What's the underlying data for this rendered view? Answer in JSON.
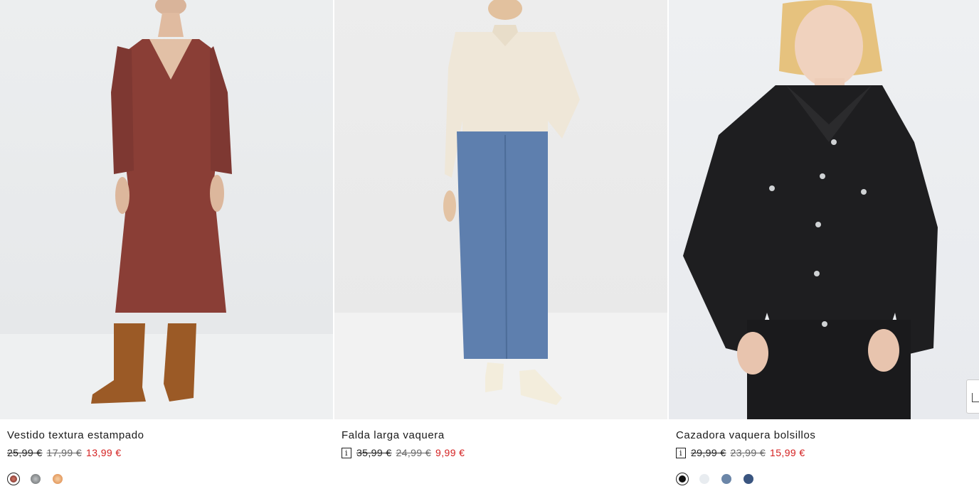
{
  "products": [
    {
      "name": "Vestido textura estampado",
      "price_original": "25,99 €",
      "price_previous": "17,99 €",
      "price_sale": "13,99 €",
      "has_info_icon": false,
      "image_icon": "dress-photo",
      "swatches": [
        {
          "name": "print-swatch",
          "color": "#9a4a44",
          "selected": true
        },
        {
          "name": "grey-swatch",
          "color": "#8a8e90",
          "selected": false
        },
        {
          "name": "orange-swatch",
          "color": "#e7a06a",
          "selected": false
        }
      ]
    },
    {
      "name": "Falda larga vaquera",
      "price_original": "35,99 €",
      "price_previous": "24,99 €",
      "price_sale": "9,99 €",
      "has_info_icon": true,
      "info_icon_text": "i",
      "image_icon": "denim-skirt-photo",
      "swatches": []
    },
    {
      "name": "Cazadora vaquera bolsillos",
      "price_original": "29,99 €",
      "price_previous": "23,99 €",
      "price_sale": "15,99 €",
      "has_info_icon": true,
      "info_icon_text": "i",
      "image_icon": "denim-jacket-photo",
      "swatches": [
        {
          "name": "black-swatch",
          "color": "#111111",
          "selected": true
        },
        {
          "name": "white-swatch",
          "color": "#e8ecf0",
          "selected": false
        },
        {
          "name": "mid-blue-swatch",
          "color": "#6b86a8",
          "selected": false
        },
        {
          "name": "dark-blue-swatch",
          "color": "#3a5580",
          "selected": false
        }
      ]
    }
  ],
  "colors": {
    "sale_price": "#d42020",
    "text": "#1a1a1a"
  }
}
